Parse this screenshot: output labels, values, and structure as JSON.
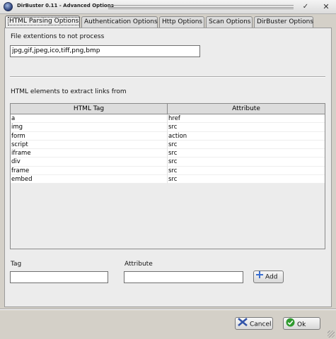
{
  "window": {
    "title": "DirBuster 0.11 - Advanced Options",
    "minimize_glyph": "✓",
    "close_glyph": "✕"
  },
  "tabs": [
    {
      "label": "HTML Parsing Options",
      "active": true
    },
    {
      "label": "Authentication Options",
      "active": false
    },
    {
      "label": "Http Options",
      "active": false
    },
    {
      "label": "Scan Options",
      "active": false
    },
    {
      "label": "DirBuster Options",
      "active": false
    }
  ],
  "html_parsing": {
    "extensions_label": "File extentions to not process",
    "extensions_value": "jpg,gif,jpeg,ico,tiff,png,bmp",
    "elements_label": "HTML elements to extract links from",
    "table": {
      "headers": [
        "HTML Tag",
        "Attribute"
      ],
      "rows": [
        [
          "a",
          "href"
        ],
        [
          "img",
          "src"
        ],
        [
          "form",
          "action"
        ],
        [
          "script",
          "src"
        ],
        [
          "iframe",
          "src"
        ],
        [
          "div",
          "src"
        ],
        [
          "frame",
          "src"
        ],
        [
          "embed",
          "src"
        ]
      ]
    },
    "tag_label": "Tag",
    "tag_value": "",
    "attribute_label": "Attribute",
    "attribute_value": "",
    "add_button": "Add"
  },
  "footer": {
    "cancel_button": "Cancel",
    "ok_button": "Ok"
  },
  "colors": {
    "add_icon": "#3a6fd0",
    "cancel_icon": "#3355aa",
    "ok_icon": "#2f9a2f"
  }
}
